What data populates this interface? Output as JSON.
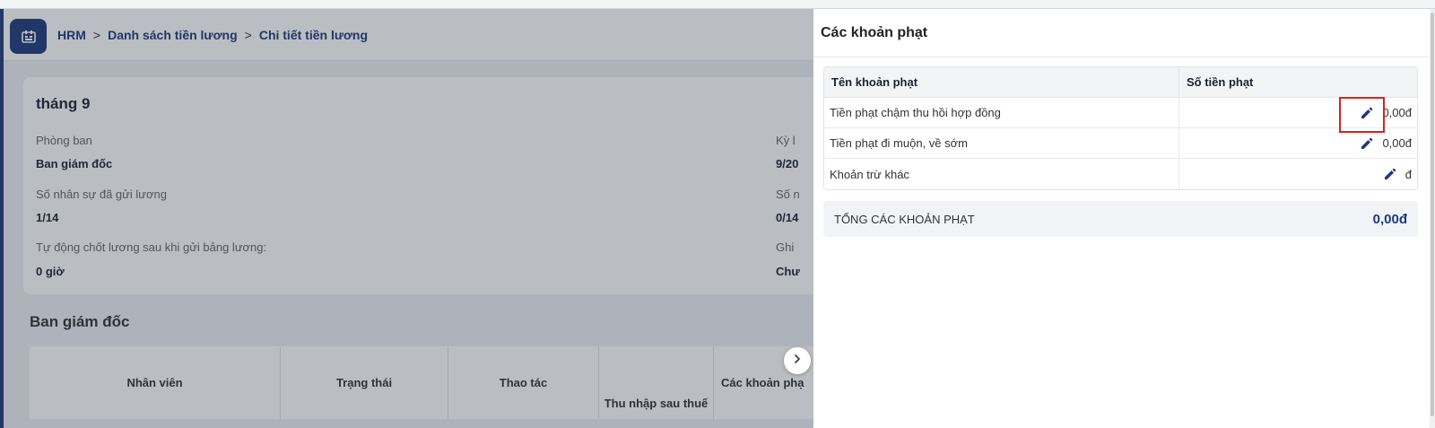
{
  "header": {
    "breadcrumb": [
      "HRM",
      "Danh sách tiền lương",
      "Chi tiết tiền lương"
    ],
    "breadcrumb_sep": ">"
  },
  "info": {
    "title": "tháng 9",
    "fields": [
      {
        "label": "Phòng ban",
        "value": "Ban giám đốc"
      },
      {
        "label": "Số nhân sự đã gửi lương",
        "value": "1/14"
      },
      {
        "label": "Tự động chốt lương sau khi gửi bảng lương:",
        "value": "0 giờ"
      }
    ],
    "right_fields": [
      {
        "label": "Kỳ l",
        "value": "9/20"
      },
      {
        "label": "Số n",
        "value": "0/14"
      },
      {
        "label": "Ghi",
        "value": "Chư"
      }
    ]
  },
  "section": {
    "title": "Ban giám đốc",
    "columns": [
      "Nhân viên",
      "Trạng thái",
      "Thao tác",
      "Thu nhập sau thuế",
      "Các khoản phạ"
    ]
  },
  "drawer": {
    "title": "Các khoản phạt",
    "table_headers": [
      "Tên khoản phạt",
      "Số tiền phạt"
    ],
    "rows": [
      {
        "name": "Tiền phạt chậm thu hồi hợp đồng",
        "amount": "0,00đ"
      },
      {
        "name": "Tiền phạt đi muộn, về sớm",
        "amount": "0,00đ"
      },
      {
        "name": "Khoản trừ khác",
        "amount": "đ"
      }
    ],
    "total_label": "TỔNG CÁC KHOẢN PHẠT",
    "total_value": "0,00đ"
  },
  "icons": {
    "logo": "hrm-logo-icon",
    "edit": "pencil-icon",
    "collapse": "chevron-right-icon"
  },
  "colors": {
    "brand": "#1e3a7b",
    "highlight": "#e01e1e"
  }
}
